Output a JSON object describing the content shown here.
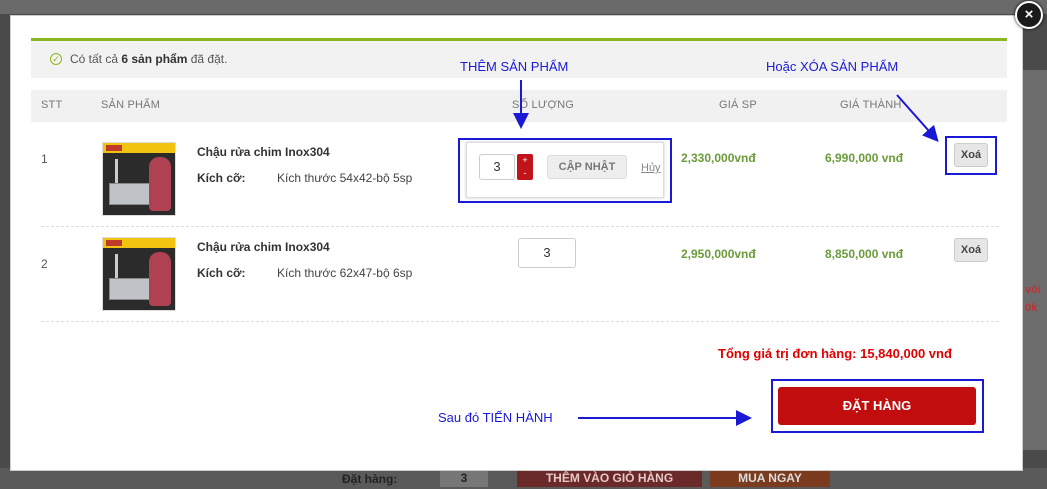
{
  "modal": {
    "close_glyph": "×",
    "notice": {
      "prefix": "Có tất cả",
      "count": "6 sản phẩm",
      "suffix": "đã đặt."
    },
    "columns": {
      "stt": "STT",
      "product": "SẢN PHẨM",
      "qty": "SỐ LƯỢNG",
      "unit_price": "GIÁ SP",
      "line_total": "GIÁ THÀNH"
    },
    "rows": [
      {
        "stt": "1",
        "name": "Chậu rửa chim Inox304",
        "size_label": "Kích cỡ:",
        "size_value": "Kích thước 54x42-bộ 5sp",
        "qty": "3",
        "unit_price": "2,330,000vnđ",
        "line_total": "6,990,000 vnđ",
        "delete": "Xoá"
      },
      {
        "stt": "2",
        "name": "Chậu rửa chim Inox304",
        "size_label": "Kích cỡ:",
        "size_value": "Kích thước 62x47-bộ 6sp",
        "qty": "3",
        "unit_price": "2,950,000vnđ",
        "line_total": "8,850,000 vnđ",
        "delete": "Xoá"
      }
    ],
    "qty_editor": {
      "plus": "+",
      "minus": "-",
      "update": "CẬP NHẬT",
      "cancel": "Hủy"
    },
    "total": "Tổng giá trị đơn hàng: 15,840,000 vnđ",
    "order_button": "ĐẶT HÀNG"
  },
  "annotations": {
    "add": "THÊM SẢN PHẨM",
    "delete": "Hoặc XÓA SẢN PHẨM",
    "proceed": "Sau đó TIẾN HÀNH",
    "color": "#1a1ad6"
  },
  "background": {
    "right_fragments": [
      "vôi",
      "0k"
    ],
    "bottom": {
      "label": "Đặt hàng:",
      "qty": "3",
      "add_to_cart": "THÊM VÀO GIỎ HÀNG",
      "buy_now": "MUA NGAY"
    }
  },
  "colors": {
    "accent_green": "#8cb61f",
    "price_green": "#6b9b3a",
    "order_red": "#c10d0d",
    "total_red": "#e00000"
  }
}
